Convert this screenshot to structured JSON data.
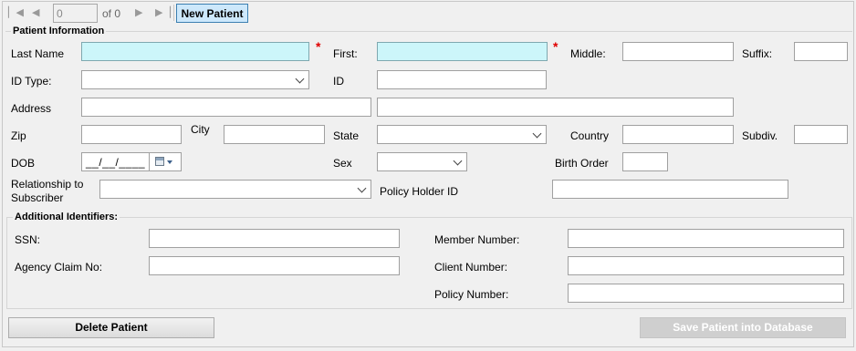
{
  "toolbar": {
    "record_value": "0",
    "record_count": "of 0",
    "new_patient": "New Patient"
  },
  "patient_info": {
    "group_title": "Patient Information",
    "last_name_label": "Last Name",
    "first_label": "First:",
    "middle_label": "Middle:",
    "suffix_label": "Suffix:",
    "id_type_label": "ID Type:",
    "id_label": "ID",
    "address_label": "Address",
    "zip_label": "Zip",
    "city_label": "City",
    "state_label": "State",
    "country_label": "Country",
    "subdiv_label": "Subdiv.",
    "dob_label": "DOB",
    "dob_value": "__/__/____",
    "sex_label": "Sex",
    "birth_order_label": "Birth Order",
    "relationship_label": "Relationship to Subscriber",
    "policy_holder_label": "Policy Holder ID",
    "required_mark": "*"
  },
  "additional": {
    "group_title": "Additional Identifiers:",
    "ssn_label": "SSN:",
    "agency_claim_label": "Agency Claim No:",
    "member_number_label": "Member Number:",
    "client_number_label": "Client Number:",
    "policy_number_label": "Policy Number:"
  },
  "buttons": {
    "delete_patient": "Delete Patient",
    "save_patient": "Save Patient into Database"
  },
  "icons": {
    "first": "first-record-icon",
    "prev": "previous-record-icon",
    "next": "next-record-icon",
    "last": "last-record-icon",
    "calendar": "calendar-icon",
    "dropdown": "chevron-down-icon"
  }
}
